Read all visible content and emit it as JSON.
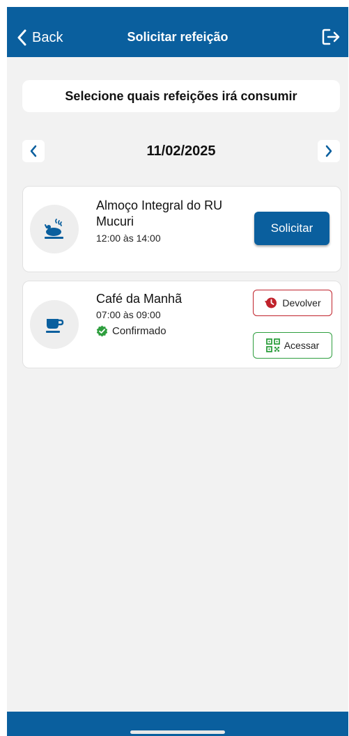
{
  "header": {
    "back_label": "Back",
    "title": "Solicitar refeição",
    "icons": {
      "back": "chevron-left-icon",
      "logout": "logout-icon"
    }
  },
  "instruction": "Selecione quais refeições irá consumir",
  "date_nav": {
    "date": "11/02/2025",
    "icons": {
      "prev": "chevron-left-icon",
      "next": "chevron-right-icon"
    }
  },
  "meals": [
    {
      "name": "Almoço Integral do RU Mucuri",
      "time": "12:00 às 14:00",
      "icon": "roast-chicken-icon",
      "action_label": "Solicitar"
    },
    {
      "name": "Café da Manhã",
      "time": "07:00 às 09:00",
      "icon": "coffee-cup-icon",
      "status": "Confirmado",
      "status_icon": "verified-check-icon",
      "return_label": "Devolver",
      "return_icon": "history-icon",
      "access_label": "Acessar",
      "access_icon": "qr-code-icon"
    }
  ],
  "colors": {
    "primary": "#0a5f9e",
    "background": "#f2f2f2",
    "danger": "#c0222b",
    "success": "#2e9e3e"
  }
}
